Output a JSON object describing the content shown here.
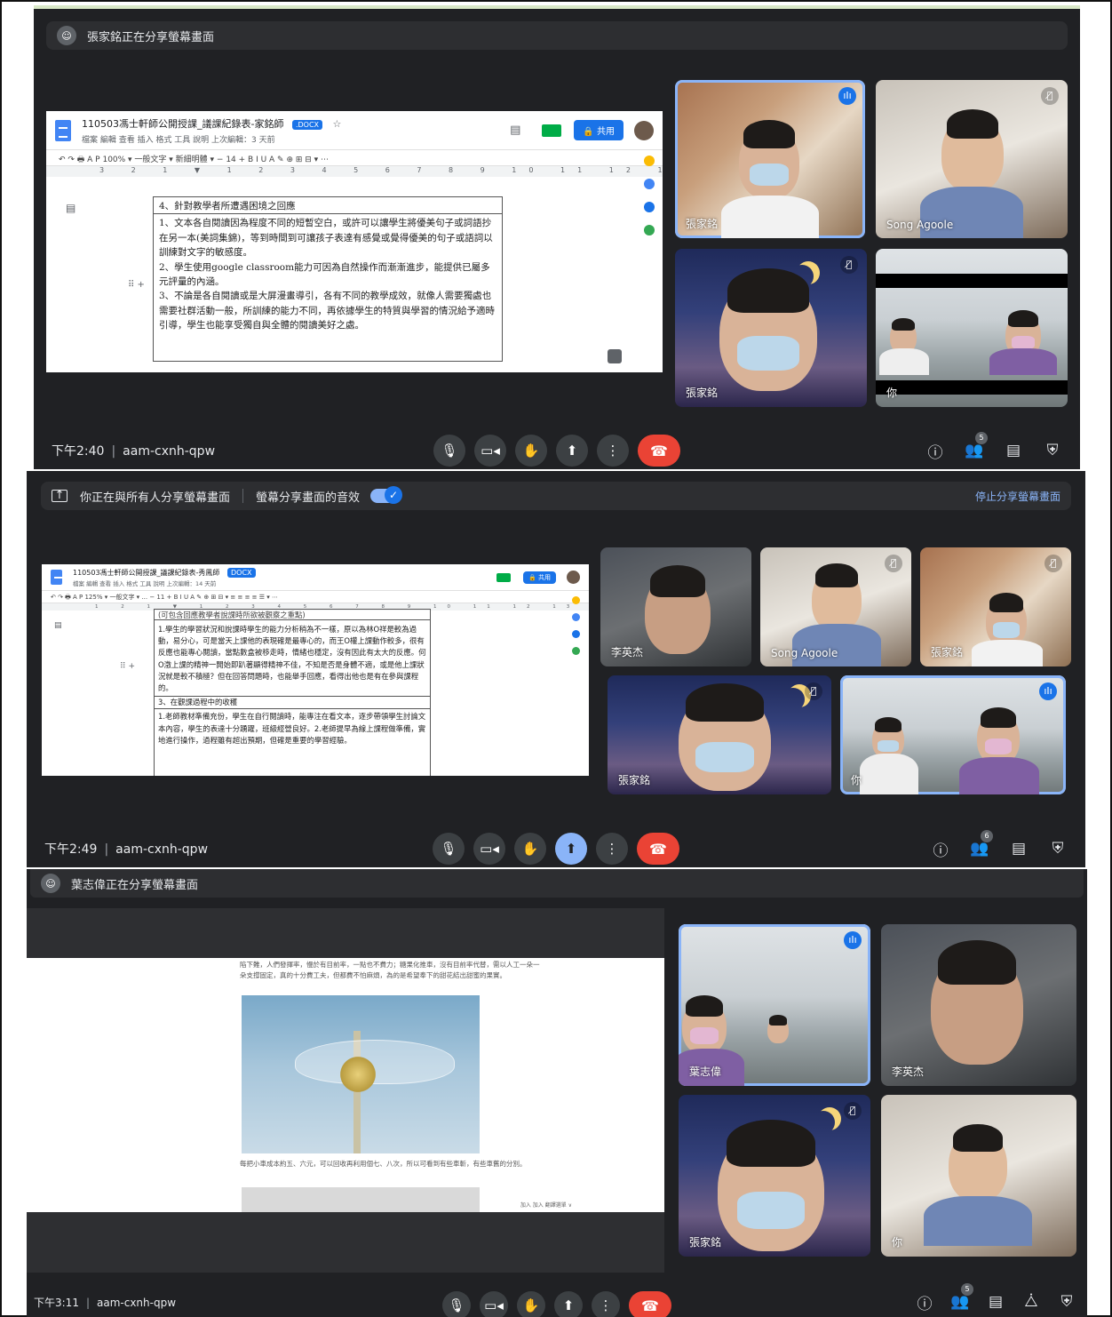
{
  "shot1": {
    "banner_text": "張家銘正在分享螢幕畫面",
    "doc": {
      "title": "110503馮士軒師公開授課_議課紀錄表-家銘師",
      "badge": ".DOCX",
      "menu": "檔案  編輯  查看  插入  格式  工具  說明   上次編輯：3 天前",
      "share": "共用",
      "tools": "↶ ↷ 🖶 A 𝖯   100% ▾   一般文字 ▾   新細明體 ▾   −  14  +   B  I  U  A  ✎   ⊕  ⊞  ⊟ ▾  ⋯",
      "ruler": "3 2 1 ▼ 1 2 3 4 5 6 7 8 9 10 11 12 13 14 15 16 17",
      "section_heading": "4、針對教學者所遭遇困境之回應",
      "paragraphs": [
        "1、文本各自閱讀因為程度不同的短暫空白，或許可以讓學生將優美句子或詞語抄在另一本(美詞集錦)，等到時間到可讓孩子表達有感覺或覺得優美的句子或語詞以訓練對文字的敏感度。",
        "2、學生使用google classroom能力可因為自然操作而漸漸進步，能提供已屬多元評量的內涵。",
        "3、不論是各自閱讀或是大屏漫畫導引，各有不同的教學成效，就像人需要獨處也需要社群活動一般，所訓練的能力不同，再依據學生的特質與學習的情況給予適時引導，學生也能享受獨自與全體的閱讀美好之處。"
      ]
    },
    "tiles": [
      {
        "name": "張家銘",
        "mic": "talking"
      },
      {
        "name": "Song Agoole",
        "mic": "muted"
      },
      {
        "name": "張家銘",
        "mic": "muted"
      },
      {
        "name": "你",
        "mic": "none"
      }
    ],
    "time": "下午2:40",
    "meeting_code": "aam-cxnh-qpw",
    "participant_count": "5"
  },
  "shot2": {
    "banner_text": "你正在與所有人分享螢幕畫面",
    "banner_audio": "螢幕分享畫面的音效",
    "stop_share": "停止分享螢幕畫面",
    "doc": {
      "title": "110503馮士軒師公開授課_議課紀錄表-秀鳳師",
      "badge": "DOCX",
      "menu": "檔案  編輯  查看  插入  格式  工具  說明   上次編輯：14 天前",
      "share": "共用",
      "tools": "↶ ↷ 🖶 A 𝖯  125% ▾  一般文字 ▾  ...  − 11 +  B I U A ✎  ⊕ ⊞ ⊟ ▾  ≡ ≡ ≡ ≡  ☰ ▾  ⋯",
      "ruler": "1 2 1 ▼ 1 2 3 4 5 6 7 8 9 10 11 12 13 14 15 16 17",
      "cut_line": "(可包含回應教學者說課時所欲被觀察之重點)",
      "paragraph1": "1.學生的學習狀況和說課時學生的能力分析稍為不一樣，原以為林O祥是較為過動，易分心，可是當天上課他的表現確是最專心的，而王O權上課動作較多，很有反應也能專心閱讀，當點數盒被移走時，情緒也穩定，沒有因此有太大的反應。何O澂上課的精神一開始即趴著顯得精神不佳，不知是否是身體不適，或是他上課狀況就是較不積極？但在回答問題時，也能舉手回應，看得出他也是有在參與課程的。",
      "section_heading": "3、在觀課過程中的收穫",
      "paragraph2": "1.老師教材準備充份，學生在自行閱讀時，能專注在看文本，逐步帶領學生討論文本內容，學生的表達十分踴躍，班級經營良好。2.老師提早為線上課程做準備，實地進行操作，過程雖有超出預期，但確是重要的學習經驗。"
    },
    "tiles": [
      {
        "name": "李英杰",
        "mic": "none"
      },
      {
        "name": "Song Agoole",
        "mic": "muted"
      },
      {
        "name": "張家銘",
        "mic": "muted"
      },
      {
        "name": "張家銘",
        "mic": "muted"
      },
      {
        "name": "你",
        "mic": "talking"
      }
    ],
    "time": "下午2:49",
    "meeting_code": "aam-cxnh-qpw",
    "participant_count": "6"
  },
  "shot3": {
    "banner_text": "葉志偉正在分享螢幕畫面",
    "slide_top_text": "陷下難，人們發揮率，慢於有目前率，一點也不費力；糖果化推車，沒有目前率代替，需以人工一朵一朵支撐固定，真的十分費工夫，但都費不怕麻煩，為的是希望奉下的甜花結出甜蜜的果實。",
    "slide_bottom_text": "每把小車成本約五、六元，可以回收再利用個七、八次，所以可看到有些車斬，有些車舊的分別。",
    "slide_footer": "加入 加入 翻譯選單 ∨",
    "tiles": [
      {
        "name": "葉志偉",
        "mic": "talking"
      },
      {
        "name": "李英杰",
        "mic": "none"
      },
      {
        "name": "張家銘",
        "mic": "muted"
      },
      {
        "name": "你",
        "mic": "none"
      }
    ],
    "time": "下午3:11",
    "meeting_code": "aam-cxnh-qpw",
    "participant_count": "5"
  },
  "icons": {
    "mic": "microphone-icon",
    "camera": "camera-icon",
    "hand": "raise-hand-icon",
    "present": "present-screen-icon",
    "more": "more-options-icon",
    "end": "end-call-icon",
    "info": "info-icon",
    "people": "people-icon",
    "chat": "chat-icon",
    "activities": "activities-icon",
    "safety": "host-controls-icon"
  },
  "colors": {
    "meet_bg": "#202124",
    "tile_active": "#8ab4f8",
    "end_call": "#ea4335",
    "doc_blue": "#1a73e8"
  }
}
